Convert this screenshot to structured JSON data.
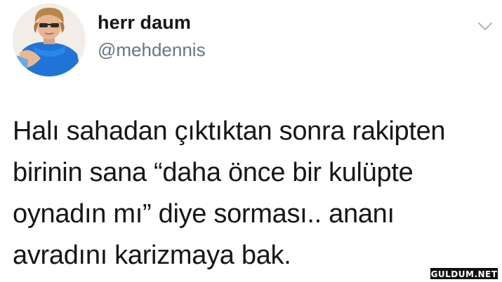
{
  "author": {
    "display_name": "herr daum",
    "handle": "@mehdennis",
    "avatar_icon": "profile-photo"
  },
  "menu": {
    "icon": "chevron-down-icon",
    "color": "#aab8c2"
  },
  "tweet": {
    "lines": [
      "Halı sahadan çıktıktan sonra rakipten",
      "birinin sana “daha önce bir kulüpte",
      "oynadın mı” diye sorması.. ananı",
      "avradını karizmaya bak."
    ]
  },
  "watermark": {
    "text": "GULDUM.NET"
  },
  "colors": {
    "text": "#14171a",
    "handle": "#657786",
    "shirt": "#1d6fd1"
  }
}
